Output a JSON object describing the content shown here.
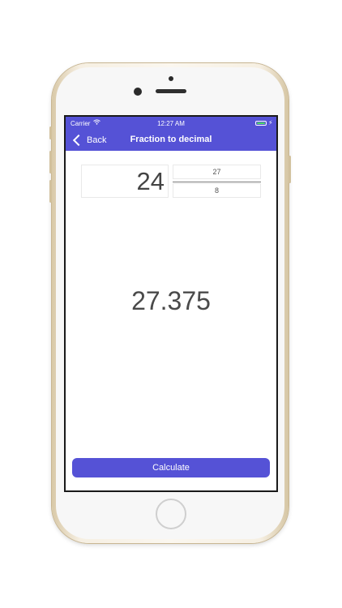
{
  "status_bar": {
    "carrier": "Carrier",
    "time": "12:27 AM",
    "wifi_icon": "wifi-icon",
    "battery_icon": "battery-icon",
    "charging_icon": "bolt-icon"
  },
  "nav": {
    "back_label": "Back",
    "title": "Fraction to decimal"
  },
  "inputs": {
    "whole": "24",
    "numerator": "27",
    "denominator": "8"
  },
  "result": "27.375",
  "calculate_label": "Calculate",
  "colors": {
    "accent": "#5552d6",
    "battery": "#4cd964"
  }
}
